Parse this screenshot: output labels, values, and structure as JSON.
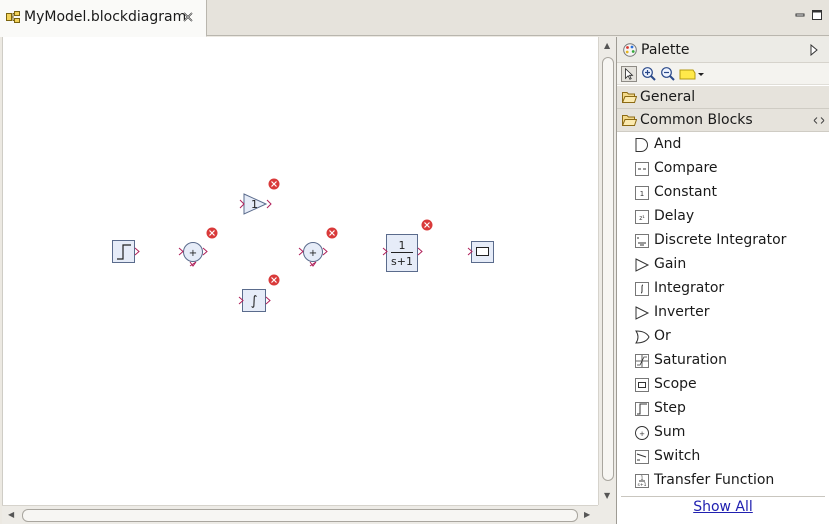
{
  "editor": {
    "tab_title": "MyModel.blockdiagram"
  },
  "diagram": {
    "blocks": [
      {
        "kind": "step"
      },
      {
        "kind": "sum1",
        "symbol": "+"
      },
      {
        "kind": "gain",
        "symbol": "1"
      },
      {
        "kind": "integrator",
        "symbol": "∫"
      },
      {
        "kind": "sum2",
        "symbol": "+"
      },
      {
        "kind": "transfer-function",
        "numerator": "1",
        "denominator": "s+1"
      },
      {
        "kind": "scope"
      }
    ],
    "error_color": "#d93a3a",
    "port_color": "#b0205a"
  },
  "palette": {
    "title": "Palette",
    "drawers": [
      "General",
      "Common Blocks"
    ],
    "items": [
      {
        "label": "And",
        "icon": "and-gate-icon"
      },
      {
        "label": "Compare",
        "icon": "compare-icon"
      },
      {
        "label": "Constant",
        "icon": "constant-icon"
      },
      {
        "label": "Delay",
        "icon": "delay-icon"
      },
      {
        "label": "Discrete Integrator",
        "icon": "discrete-integrator-icon"
      },
      {
        "label": "Gain",
        "icon": "gain-icon"
      },
      {
        "label": "Integrator",
        "icon": "integrator-icon"
      },
      {
        "label": "Inverter",
        "icon": "inverter-icon"
      },
      {
        "label": "Or",
        "icon": "or-gate-icon"
      },
      {
        "label": "Saturation",
        "icon": "saturation-icon"
      },
      {
        "label": "Scope",
        "icon": "scope-icon"
      },
      {
        "label": "Step",
        "icon": "step-icon"
      },
      {
        "label": "Sum",
        "icon": "sum-icon"
      },
      {
        "label": "Switch",
        "icon": "switch-icon"
      },
      {
        "label": "Transfer Function",
        "icon": "transfer-function-icon"
      }
    ],
    "show_all": "Show All"
  }
}
